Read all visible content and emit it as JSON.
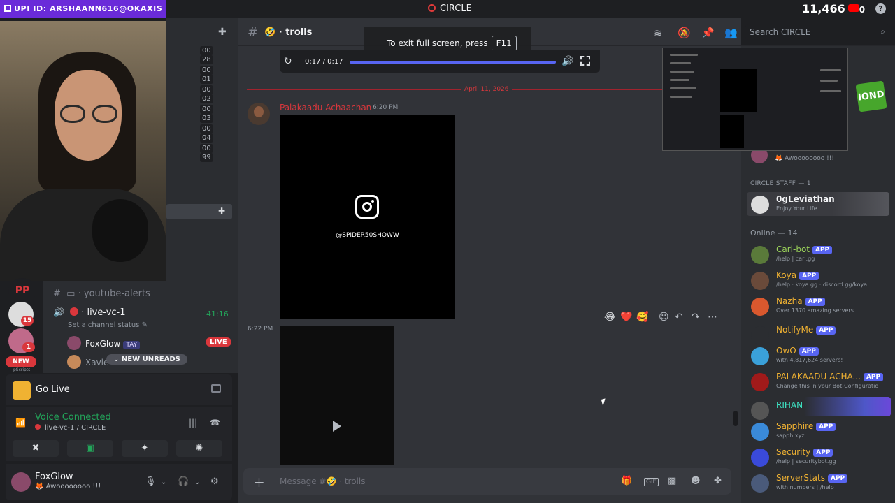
{
  "topbar": {
    "upi": "UPI ID: ARSHAANN616@OKAXIS",
    "server": "CIRCLE",
    "subs": "11,466",
    "subs_suffix": "0"
  },
  "chanbar": {
    "nums": [
      [
        "00",
        "28"
      ],
      [
        "00",
        "01"
      ],
      [
        "00",
        "02"
      ],
      [
        "00",
        "03"
      ],
      [
        "00",
        "04"
      ],
      [
        "00",
        "99"
      ]
    ]
  },
  "rail": {
    "badges": [
      "15",
      "1"
    ],
    "new_label": "NEW",
    "pp_label": "pScripts"
  },
  "channels": {
    "youtube": "youtube-alerts",
    "live": "live-vc-1",
    "timer": "41:16",
    "status": "Set a channel status",
    "user1": "FoxGlow",
    "user1_tag": "TAY",
    "live_pill": "LIVE",
    "user2": "Xavie",
    "unreads": "NEW UNREADS"
  },
  "golive": {
    "label": "Go Live"
  },
  "voice": {
    "title": "Voice Connected",
    "sub": "live-vc-1 / CIRCLE"
  },
  "user": {
    "name": "FoxGlow",
    "status": "🦊 Awoooooooo !!!"
  },
  "header": {
    "channel": "trolls",
    "search_placeholder": "Search CIRCLE"
  },
  "toast": {
    "text": "To exit full screen, press",
    "key": "F11"
  },
  "player": {
    "time": "0:17 / 0:17",
    "progress": 1.0
  },
  "chat": {
    "divider": "April 11, 2026",
    "author": "Palakaadu Achaachan",
    "time1": "6:20 PM",
    "ig_handle": "@SPIDER50SHOWW",
    "time2": "6:22 PM",
    "reactions": [
      "😂",
      "❤️",
      "🥰"
    ]
  },
  "composer": {
    "placeholder": "Message #🤣 · trolls"
  },
  "members": {
    "prev_status": "🦊 Awoooooooo !!!",
    "staff_header": "CIRCLE STAFF — 1",
    "staff": {
      "name": "0gLeviathan",
      "status": "Enjoy Your Life"
    },
    "online_header": "Online — 14",
    "list": [
      {
        "name": "Carl-bot",
        "sub": "/help | carl.gg",
        "color": "#9bd35a",
        "av": "#5a7a3a",
        "app": "APP"
      },
      {
        "name": "Koya",
        "sub": "/help · koya.gg · discord.gg/koya",
        "color": "#f0b232",
        "av": "#6a4a3a",
        "app": "APP"
      },
      {
        "name": "Nazha",
        "sub": "Over 1370 amazing servers.",
        "color": "#f0b232",
        "av": "#d9582e",
        "app": "APP"
      },
      {
        "name": "NotifyMe",
        "sub": "",
        "color": "#f0b232",
        "av": "#2b2d31",
        "app": "APP"
      },
      {
        "name": "OwO",
        "sub": "with 4,817,624 servers!",
        "color": "#f0b232",
        "av": "#3aa0d9",
        "app": "APP"
      },
      {
        "name": "PALAKAADU ACHA...",
        "sub": "Change this in your Bot-Configuratio",
        "color": "#f0b232",
        "av": "#a01a1a",
        "app": "APP"
      },
      {
        "name": "RIHAN",
        "sub": "",
        "color": "#3ee8c8",
        "av": "#555",
        "app": ""
      },
      {
        "name": "Sapphire",
        "sub": "sapph.xyz",
        "color": "#f0b232",
        "av": "#3a8ad9",
        "app": "APP"
      },
      {
        "name": "Security",
        "sub": "/help | securitybot.gg",
        "color": "#f0b232",
        "av": "#3a4ad9",
        "app": "APP"
      },
      {
        "name": "ServerStats",
        "sub": "with numbers | /help",
        "color": "#f0b232",
        "av": "#4a5a7a",
        "app": "APP"
      }
    ]
  },
  "colors": {
    "accent": "#5865f2",
    "danger": "#da373c",
    "online": "#23a55a"
  },
  "icons": [
    "hash-icon",
    "search-icon",
    "help-icon",
    "threads-icon",
    "pin-icon",
    "members-icon",
    "mute-icon",
    "replay-icon",
    "volume-icon",
    "fullscreen-icon",
    "plus-icon",
    "gift-icon",
    "gif-icon",
    "sticker-icon",
    "emoji-icon",
    "apps-icon",
    "mic-icon",
    "headphones-icon",
    "gear-icon"
  ]
}
